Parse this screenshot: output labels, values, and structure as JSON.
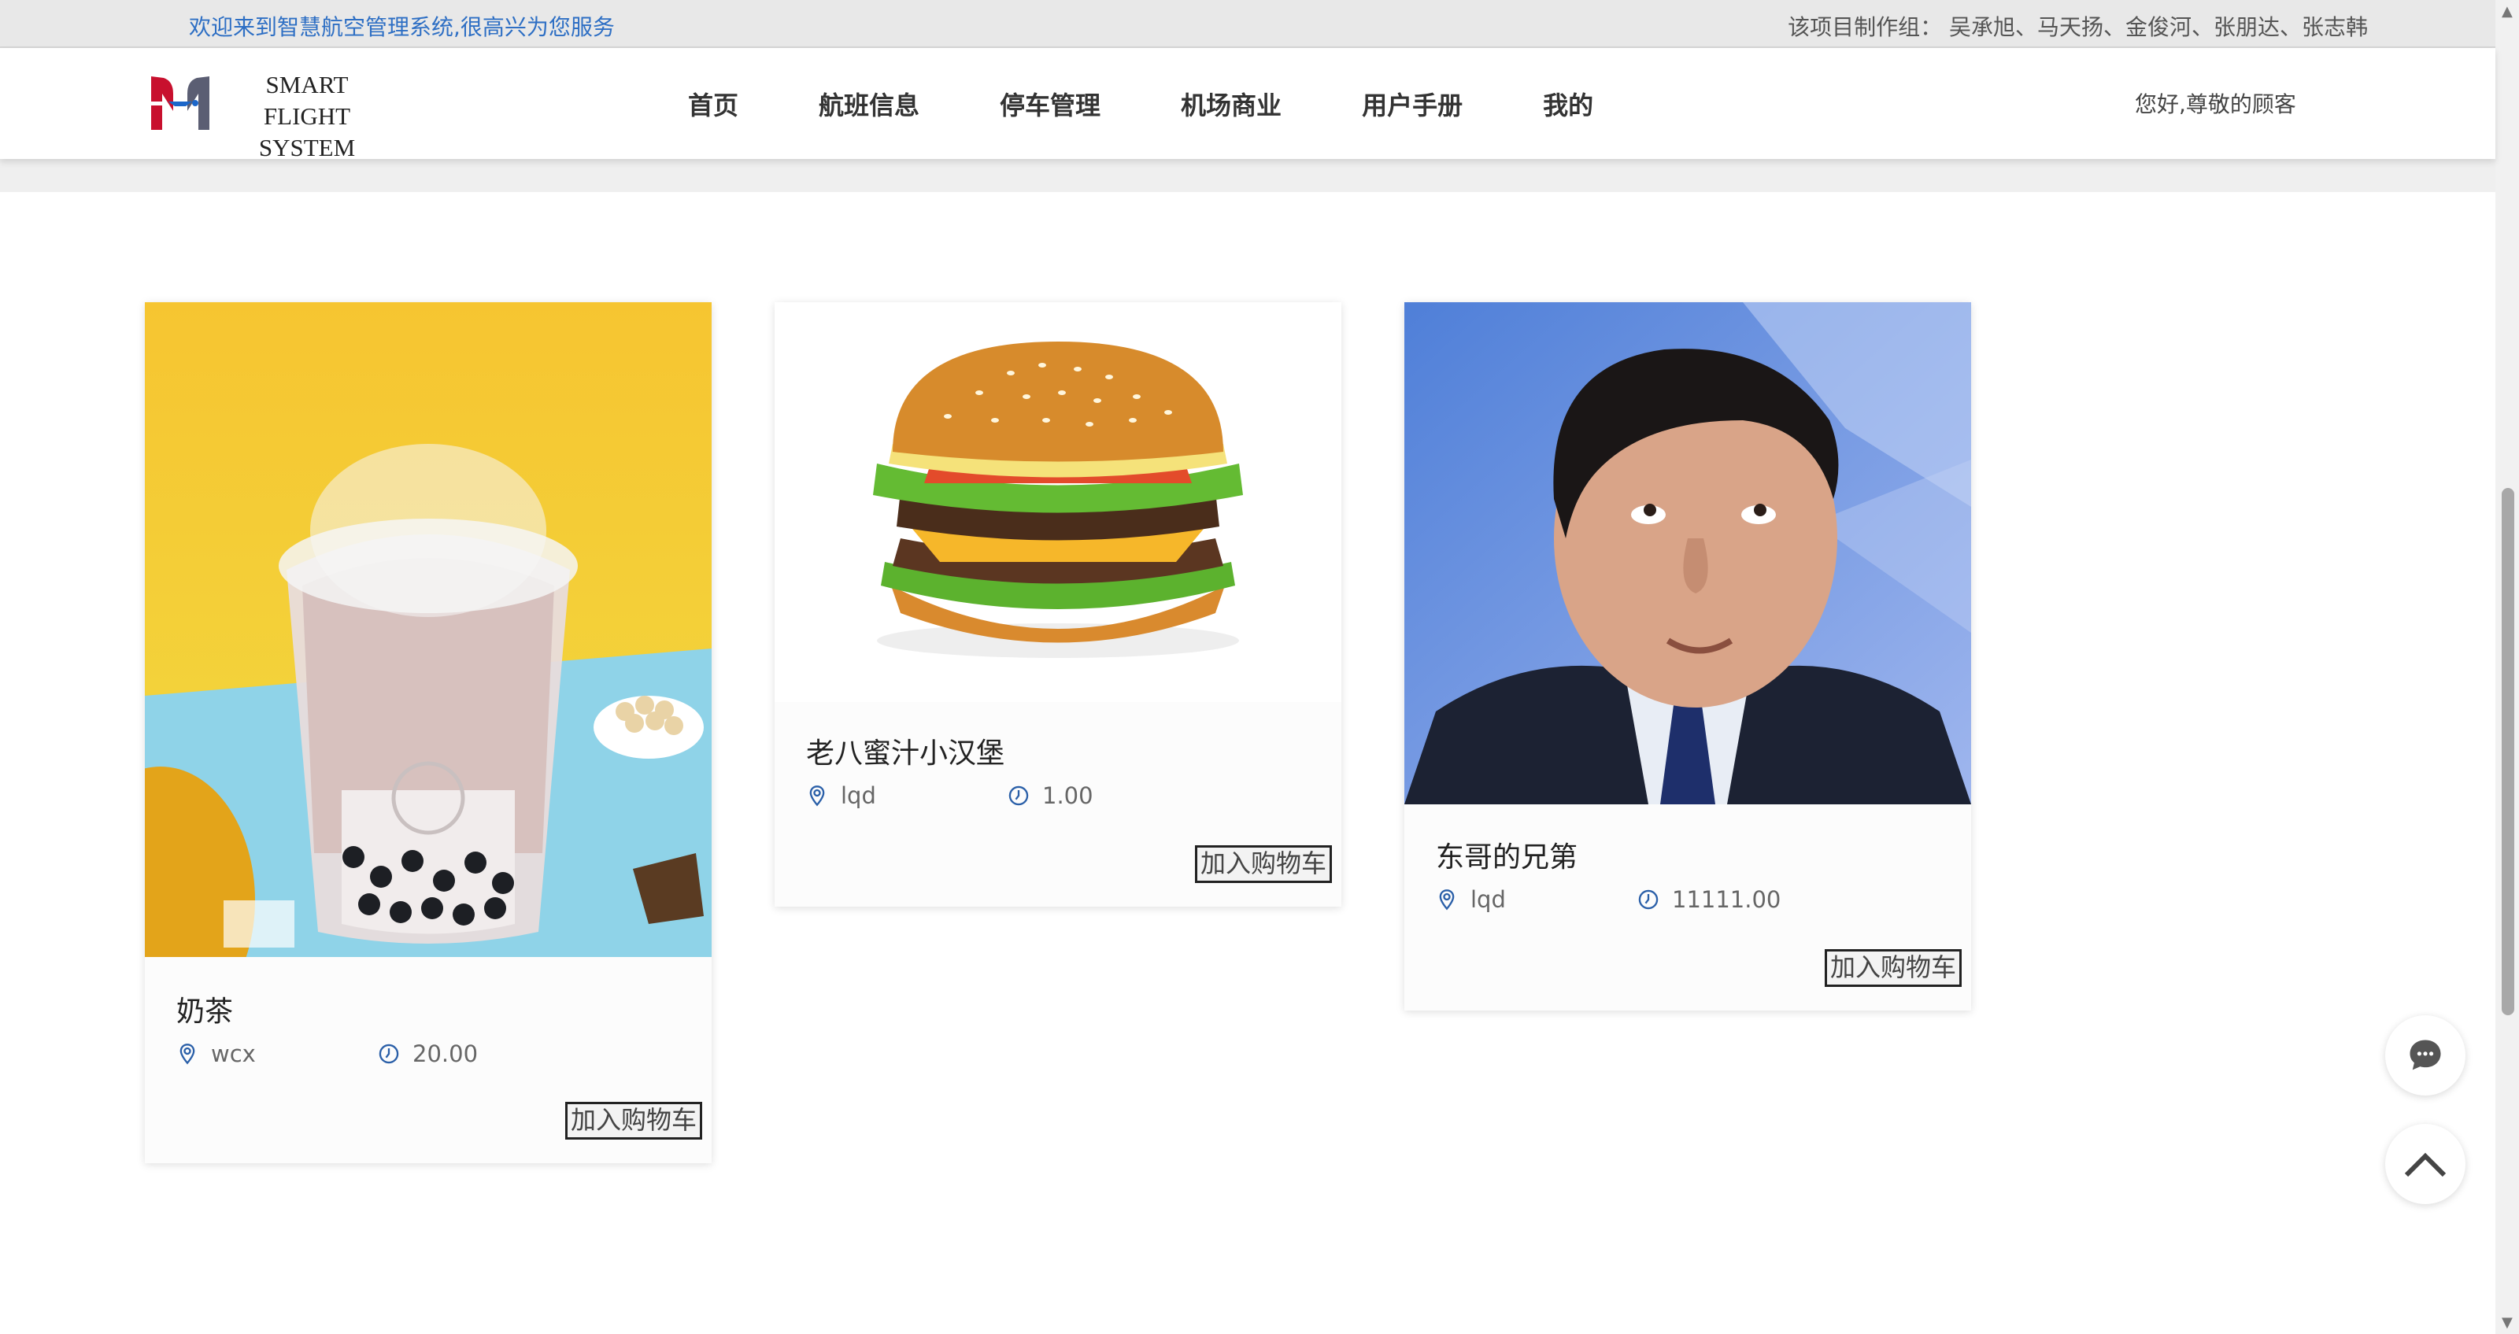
{
  "topbar": {
    "welcome": "欢迎来到智慧航空管理系统,很高兴为您服务",
    "team": "该项目制作组： 吴承旭、马天扬、金俊河、张朋达、张志韩"
  },
  "header": {
    "logo_line1": "SMART FLIGHT",
    "logo_line2": "SYSTEM",
    "nav": [
      "首页",
      "航班信息",
      "停车管理",
      "机场商业",
      "用户手册",
      "我的"
    ],
    "greeting": "您好,尊敬的顾客"
  },
  "products": [
    {
      "name": "奶茶",
      "seller": "wcx",
      "price": "20.00",
      "button": "加入购物车"
    },
    {
      "name": "老八蜜汁小汉堡",
      "seller": "lqd",
      "price": "1.00",
      "button": "加入购物车"
    },
    {
      "name": "东哥的兄第",
      "seller": "lqd",
      "price": "11111.00",
      "button": "加入购物车"
    }
  ],
  "icons": {
    "location": "location-pin-icon",
    "clock": "clock-icon",
    "chat": "chat-icon",
    "back_to_top": "chevron-up-icon"
  },
  "colors": {
    "accent_blue": "#2e6fc4",
    "logo_red": "#c8102e",
    "icon_blue": "#2a5fa8"
  }
}
